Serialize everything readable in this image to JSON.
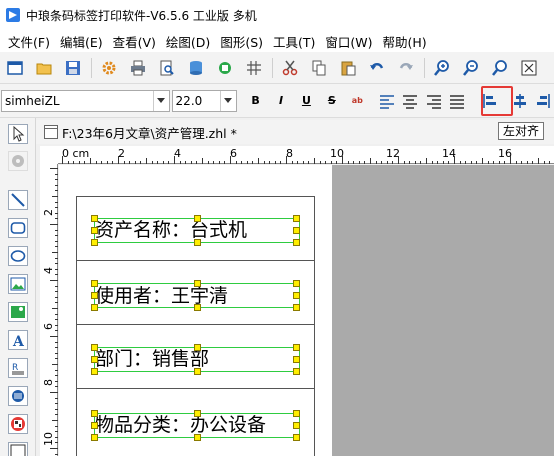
{
  "window": {
    "title": "中琅条码标签打印软件-V6.5.6 工业版 多机"
  },
  "menu": [
    "文件(F)",
    "编辑(E)",
    "查看(V)",
    "绘图(D)",
    "图形(S)",
    "工具(T)",
    "窗口(W)",
    "帮助(H)"
  ],
  "toolbar_icons": [
    "new-icon",
    "open-icon",
    "save-icon",
    "settings-icon",
    "print-icon",
    "print-preview-icon",
    "database-icon",
    "data-source-icon",
    "grid-icon",
    "cut-icon",
    "copy-icon",
    "paste-icon",
    "undo-icon",
    "redo-icon",
    "zoom-in-icon",
    "zoom-out-icon",
    "zoom-fit-icon",
    "zoom-page-icon"
  ],
  "format": {
    "font": "simheiZL",
    "size": "22.0",
    "bold": "B",
    "italic": "I",
    "underline": "U",
    "strike": "S",
    "sub": "ab",
    "align_left_tooltip": "左对齐"
  },
  "document": {
    "tab_title": "F:\\23年6月文章\\资产管理.zhl *"
  },
  "ruler": {
    "h_labels": [
      "0 cm",
      "2",
      "4",
      "6",
      "8",
      "10",
      "12",
      "14",
      "16"
    ],
    "v_labels": [
      "2",
      "4",
      "6",
      "8",
      "10"
    ]
  },
  "label": {
    "fields": [
      "资产名称：台式机",
      "使用者：王宇清",
      "部门：销售部",
      "物品分类：办公设备"
    ]
  },
  "colors": {
    "highlight": "#e53935",
    "handle": "#ffee00",
    "selection": "#2ecc40",
    "canvas": "#aaaaaa"
  }
}
